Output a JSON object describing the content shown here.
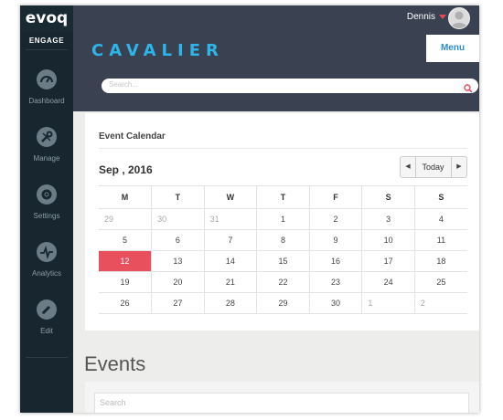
{
  "app": {
    "logo_text": "evoq",
    "product": "ENGAGE",
    "site_title": "CAVALIER"
  },
  "topbar": {
    "user_name": "Dennis",
    "menu_label": "Menu"
  },
  "search": {
    "placeholder": "Search..."
  },
  "sidebar": {
    "items": [
      {
        "label": "Dashboard",
        "icon": "speedometer-icon"
      },
      {
        "label": "Manage",
        "icon": "wrench-icon"
      },
      {
        "label": "Settings",
        "icon": "gear-icon"
      },
      {
        "label": "Analytics",
        "icon": "pulse-icon"
      },
      {
        "label": "Edit",
        "icon": "pencil-icon"
      }
    ]
  },
  "calendar": {
    "title": "Event Calendar",
    "month_label": "Sep , 2016",
    "today_label": "Today",
    "prev_icon": "caret-left-icon",
    "next_icon": "caret-right-icon",
    "weekdays": [
      "M",
      "T",
      "W",
      "T",
      "F",
      "S",
      "S"
    ],
    "weeks": [
      [
        "29",
        "30",
        "31",
        "1",
        "2",
        "3",
        "4"
      ],
      [
        "5",
        "6",
        "7",
        "8",
        "9",
        "10",
        "11"
      ],
      [
        "12",
        "13",
        "14",
        "15",
        "16",
        "17",
        "18"
      ],
      [
        "19",
        "20",
        "21",
        "22",
        "23",
        "24",
        "25"
      ],
      [
        "26",
        "27",
        "28",
        "29",
        "30",
        "1",
        "2"
      ]
    ],
    "selected_day": "12",
    "selected_color": "#e8505e"
  },
  "events": {
    "title": "Events",
    "search_placeholder": "Search"
  },
  "colors": {
    "sidebar": "#17262f",
    "header": "#3a4150",
    "brand": "#2db4e8",
    "accent": "#e8485f"
  }
}
